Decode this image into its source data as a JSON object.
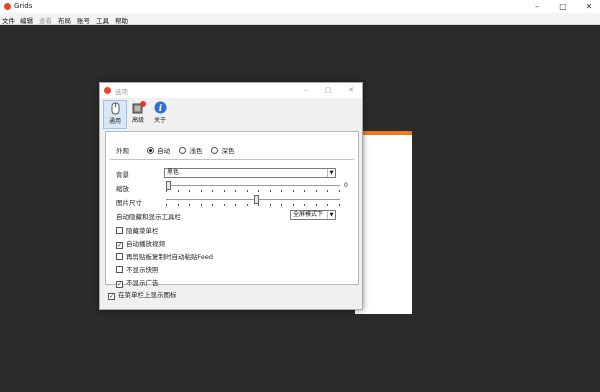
{
  "window": {
    "title": "Grids",
    "controls": [
      "–",
      "□",
      "✕"
    ]
  },
  "menu": [
    {
      "label": "文件",
      "disabled": false
    },
    {
      "label": "编辑",
      "disabled": false
    },
    {
      "label": "查看",
      "disabled": true
    },
    {
      "label": "布局",
      "disabled": false
    },
    {
      "label": "账号",
      "disabled": false
    },
    {
      "label": "工具",
      "disabled": false
    },
    {
      "label": "帮助",
      "disabled": false
    }
  ],
  "dialog": {
    "title": "选项",
    "controls": [
      "–",
      "□",
      "✕"
    ],
    "toolbar": [
      {
        "label": "通用",
        "icon": "settings-icon",
        "selected": true
      },
      {
        "label": "高级",
        "icon": "advanced-icon",
        "selected": false
      },
      {
        "label": "关于",
        "icon": "info-icon",
        "selected": false
      }
    ],
    "appearance": {
      "label": "外观",
      "options": [
        {
          "label": "自动",
          "selected": true
        },
        {
          "label": "浅色",
          "selected": false
        },
        {
          "label": "深色",
          "selected": false
        }
      ]
    },
    "background": {
      "label": "背景",
      "value": "黑色"
    },
    "zoom": {
      "label": "缩放",
      "value": 0.0,
      "scale_end_label": "0"
    },
    "image_size": {
      "label": "图片尺寸",
      "value": 0.52
    },
    "auto_hide": {
      "label": "自动隐藏和显示工具栏",
      "value": "全屏模式下"
    },
    "checkboxes": [
      {
        "label": "隐藏菜单栏",
        "checked": false
      },
      {
        "label": "自动播放视频",
        "checked": true
      },
      {
        "label": "再剪贴板复制时自动粘贴Feed",
        "checked": false
      },
      {
        "label": "不显示快照",
        "checked": false
      },
      {
        "label": "不显示广告",
        "checked": true
      }
    ],
    "bottom_checkbox": {
      "label": "在菜单栏上显示图标",
      "checked": true
    }
  },
  "colors": {
    "accent": "#e8462b",
    "background_window_bar": "#f07a1d",
    "desktop": "#2b2b2b"
  }
}
